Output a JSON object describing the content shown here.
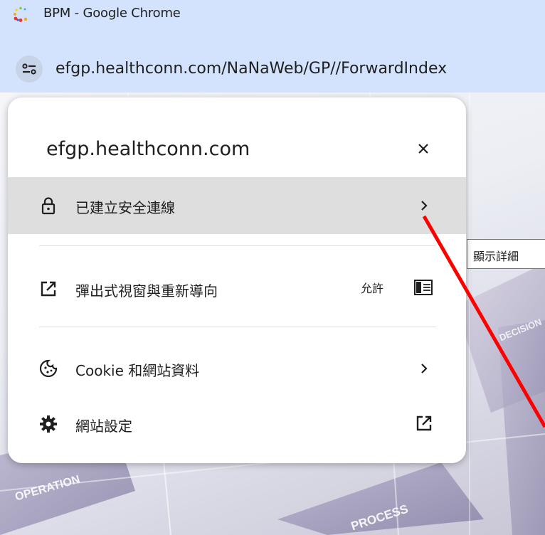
{
  "window": {
    "title": "BPM - Google Chrome"
  },
  "address_bar": {
    "url": "efgp.healthconn.com/NaNaWeb/GP//ForwardIndex"
  },
  "page": {
    "background_words": [
      "OPERATION",
      "PROCESS",
      "DECISION"
    ],
    "tooltip": "顯示詳細"
  },
  "site_info_popup": {
    "domain": "efgp.healthconn.com",
    "close_icon": "close-icon",
    "secure_connection": {
      "label": "已建立安全連線",
      "icon": "lock-icon"
    },
    "popups_redirects": {
      "label": "彈出式視窗與重新導向",
      "status": "允許",
      "icon": "open-in-new-icon",
      "toggle_icon": "toggle-icon"
    },
    "cookies": {
      "label": "Cookie 和網站資料",
      "icon": "cookie-icon"
    },
    "site_settings": {
      "label": "網站設定",
      "icon": "gear-icon"
    }
  },
  "colors": {
    "titlebar": "#d3e3fd",
    "popup_bg": "#ffffff",
    "highlight_row": "#dedede",
    "annotation_red": "#ff0000"
  }
}
